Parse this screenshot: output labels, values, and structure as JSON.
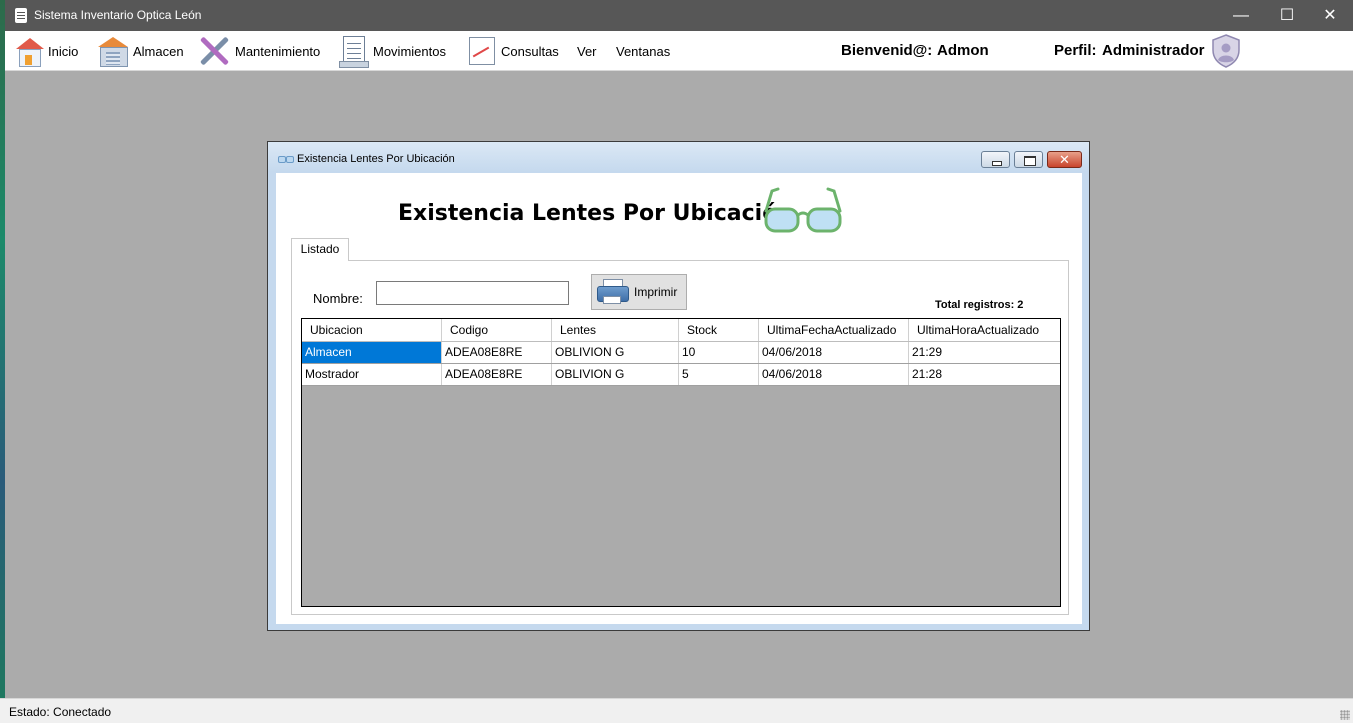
{
  "app": {
    "title": "Sistema Inventario Optica León"
  },
  "window_controls": {
    "minimize": "—",
    "maximize": "☐",
    "close": "✕"
  },
  "menu": {
    "items": [
      {
        "label": "Inicio",
        "icon": "home-icon"
      },
      {
        "label": "Almacen",
        "icon": "warehouse-icon"
      },
      {
        "label": "Mantenimiento",
        "icon": "tools-icon"
      },
      {
        "label": "Movimientos",
        "icon": "document-icon"
      },
      {
        "label": "Consultas",
        "icon": "chart-icon"
      },
      {
        "label": "Ver"
      },
      {
        "label": "Ventanas"
      }
    ],
    "welcome_label": "Bienvenid@:",
    "welcome_user": "Admon",
    "profile_label": "Perfil:",
    "profile_value": "Administrador",
    "profile_icon": "shield-user-icon"
  },
  "child_window": {
    "title": "Existencia Lentes Por Ubicación",
    "close_glyph": "✕"
  },
  "form": {
    "heading": "Existencia Lentes Por Ubicación",
    "tab_label": "Listado",
    "nombre_label": "Nombre:",
    "nombre_value": "",
    "print_button": "Imprimir",
    "total_label": "Total registros: 2"
  },
  "grid": {
    "columns": [
      "Ubicacion",
      "Codigo",
      "Lentes",
      "Stock",
      "UltimaFechaActualizado",
      "UltimaHoraActualizado"
    ],
    "rows": [
      [
        "Almacen",
        "ADEA08E8RE",
        "OBLIVION G",
        "10",
        "04/06/2018",
        "21:29"
      ],
      [
        "Mostrador",
        "ADEA08E8RE",
        "OBLIVION G",
        "5",
        "04/06/2018",
        "21:28"
      ]
    ],
    "selected_color": "#0078d7"
  },
  "status": {
    "text": "Estado: Conectado"
  }
}
